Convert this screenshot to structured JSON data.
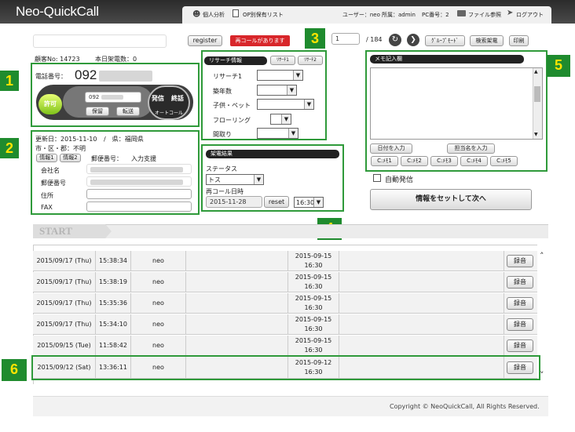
{
  "app": {
    "title": "Neo-QuickCall"
  },
  "topnav": {
    "personal_analysis": "個人分析",
    "op_report": "OP別保有リスト",
    "user_label": "ユーザー：neo",
    "affiliation": "所属：admin",
    "pc_number": "PC番号：2",
    "file_reference": "ファイル参照",
    "logout": "ログアウト"
  },
  "toolbar": {
    "register": "register",
    "recall_notice": "再コールがあります",
    "page_current": "1",
    "page_total": "/ 184",
    "group_mode": "ｸﾞﾙｰﾌﾟﾓｰﾄﾞ",
    "search_call": "検索架電",
    "print": "印刷"
  },
  "customer": {
    "number": "顧客No: 14723",
    "today_calls": "本日架電数：0"
  },
  "phone": {
    "label": "電話番号：",
    "number": "092",
    "allow": "許可",
    "line_number": "092",
    "hold": "保留",
    "transfer": "転送",
    "call": "発信",
    "end": "終話",
    "autocall": "オートコール"
  },
  "info": {
    "updated": "更新日：2015-11-10",
    "prefecture": "/　県：福岡県",
    "city": "市・区・郡：不明",
    "tab1": "情報1",
    "tab2": "情報2",
    "postal_label": "郵便番号：",
    "input_support": "入力支援",
    "company": "会社名",
    "postal": "郵便番号",
    "address": "住所",
    "fax": "FAX"
  },
  "research": {
    "title": "リサーチ情報",
    "tab1": "ﾘｻｰﾁ1",
    "tab2": "ﾘｻｰﾁ2",
    "fields": [
      "リサーチ1",
      "築年数",
      "子供・ペット",
      "フローリング",
      "間取り"
    ]
  },
  "result": {
    "title": "架電結果",
    "status_label": "ステータス",
    "status_value": "トス",
    "recall_label": "再コール日時",
    "date": "2015-11-28",
    "reset": "reset",
    "time": "16:30"
  },
  "memo": {
    "title": "メモ記入欄",
    "date_input": "日付を入力",
    "person_input": "担当名を入力",
    "memos": [
      "C:ﾒﾓ1",
      "C:ﾒﾓ2",
      "C:ﾒﾓ3",
      "C:ﾒﾓ4",
      "C:ﾒﾓ5"
    ],
    "auto_dial": "自動発信",
    "next_button": "情報をセットして次へ"
  },
  "start_label": "START",
  "history": [
    {
      "date": "2015/09/17 (Thu)",
      "time": "15:38:34",
      "op": "neo",
      "recall": "2015-09-15",
      "recall_time": "16:30",
      "rec": "録音"
    },
    {
      "date": "2015/09/17 (Thu)",
      "time": "15:38:19",
      "op": "neo",
      "recall": "2015-09-15",
      "recall_time": "16:30",
      "rec": "録音"
    },
    {
      "date": "2015/09/17 (Thu)",
      "time": "15:35:36",
      "op": "neo",
      "recall": "2015-09-15",
      "recall_time": "16:30",
      "rec": "録音"
    },
    {
      "date": "2015/09/17 (Thu)",
      "time": "15:34:10",
      "op": "neo",
      "recall": "2015-09-15",
      "recall_time": "16:30",
      "rec": "録音"
    },
    {
      "date": "2015/09/15 (Tue)",
      "time": "11:58:42",
      "op": "neo",
      "recall": "2015-09-15",
      "recall_time": "16:30",
      "rec": "録音"
    },
    {
      "date": "2015/09/12 (Sat)",
      "time": "13:36:11",
      "op": "neo",
      "recall": "2015-09-12",
      "recall_time": "16:30",
      "rec": "録音"
    }
  ],
  "annotations": [
    "1",
    "2",
    "3",
    "4",
    "5",
    "6"
  ],
  "footer": {
    "copyright": "Copyright © NeoQuickCall, All Rights Reserved."
  },
  "colors": {
    "accent_green": "#2f9a3a",
    "label_bg": "#1f8b2e",
    "label_text": "#ffe400",
    "recall_red": "#d8262a"
  }
}
